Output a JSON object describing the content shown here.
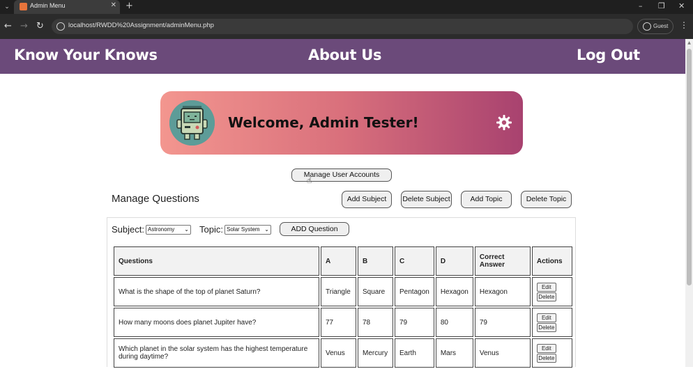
{
  "browser": {
    "tab_title": "Admin Menu",
    "url": "localhost/RWDD%20Assignment/adminMenu.php",
    "profile_label": "Guest"
  },
  "header": {
    "brand": "Know Your Knows",
    "about": "About Us",
    "logout": "Log Out"
  },
  "welcome": {
    "text": "Welcome, Admin Tester!"
  },
  "buttons": {
    "manage_users": "Manage User Accounts",
    "add_subject": "Add Subject",
    "delete_subject": "Delete Subject",
    "add_topic": "Add Topic",
    "delete_topic": "Delete Topic",
    "add_question": "ADD Question",
    "edit": "Edit",
    "delete": "Delete"
  },
  "questions_section": {
    "title": "Manage Questions",
    "subject_label": "Subject:",
    "subject_value": "Astronomy",
    "topic_label": "Topic:",
    "topic_value": "Solar System"
  },
  "table": {
    "headers": [
      "Questions",
      "A",
      "B",
      "C",
      "D",
      "Correct Answer",
      "Actions"
    ],
    "rows": [
      [
        "What is the shape of the top of planet Saturn?",
        "Triangle",
        "Square",
        "Pentagon",
        "Hexagon",
        "Hexagon"
      ],
      [
        "How many moons does planet Jupiter have?",
        "77",
        "78",
        "79",
        "80",
        "79"
      ],
      [
        "Which planet in the solar system has the highest temperature during daytime?",
        "Venus",
        "Mercury",
        "Earth",
        "Mars",
        "Venus"
      ]
    ]
  }
}
